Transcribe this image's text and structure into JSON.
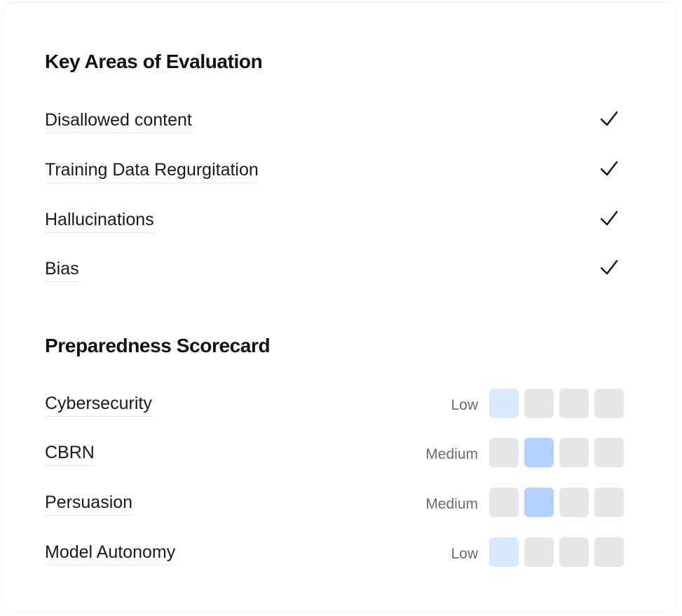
{
  "evaluation": {
    "title": "Key Areas of Evaluation",
    "items": [
      {
        "label": "Disallowed content",
        "checked": true
      },
      {
        "label": "Training Data Regurgitation",
        "checked": true
      },
      {
        "label": "Hallucinations",
        "checked": true
      },
      {
        "label": "Bias",
        "checked": true
      }
    ]
  },
  "scorecard": {
    "title": "Preparedness Scorecard",
    "level_scale": 4,
    "colors": {
      "inactive": "#e6e6e6",
      "low": "#dbe9ff",
      "medium": "#b4d2ff"
    },
    "items": [
      {
        "label": "Cybersecurity",
        "level_text": "Low",
        "level": 1
      },
      {
        "label": "CBRN",
        "level_text": "Medium",
        "level": 2
      },
      {
        "label": "Persuasion",
        "level_text": "Medium",
        "level": 2
      },
      {
        "label": "Model Autonomy",
        "level_text": "Low",
        "level": 1
      }
    ]
  }
}
